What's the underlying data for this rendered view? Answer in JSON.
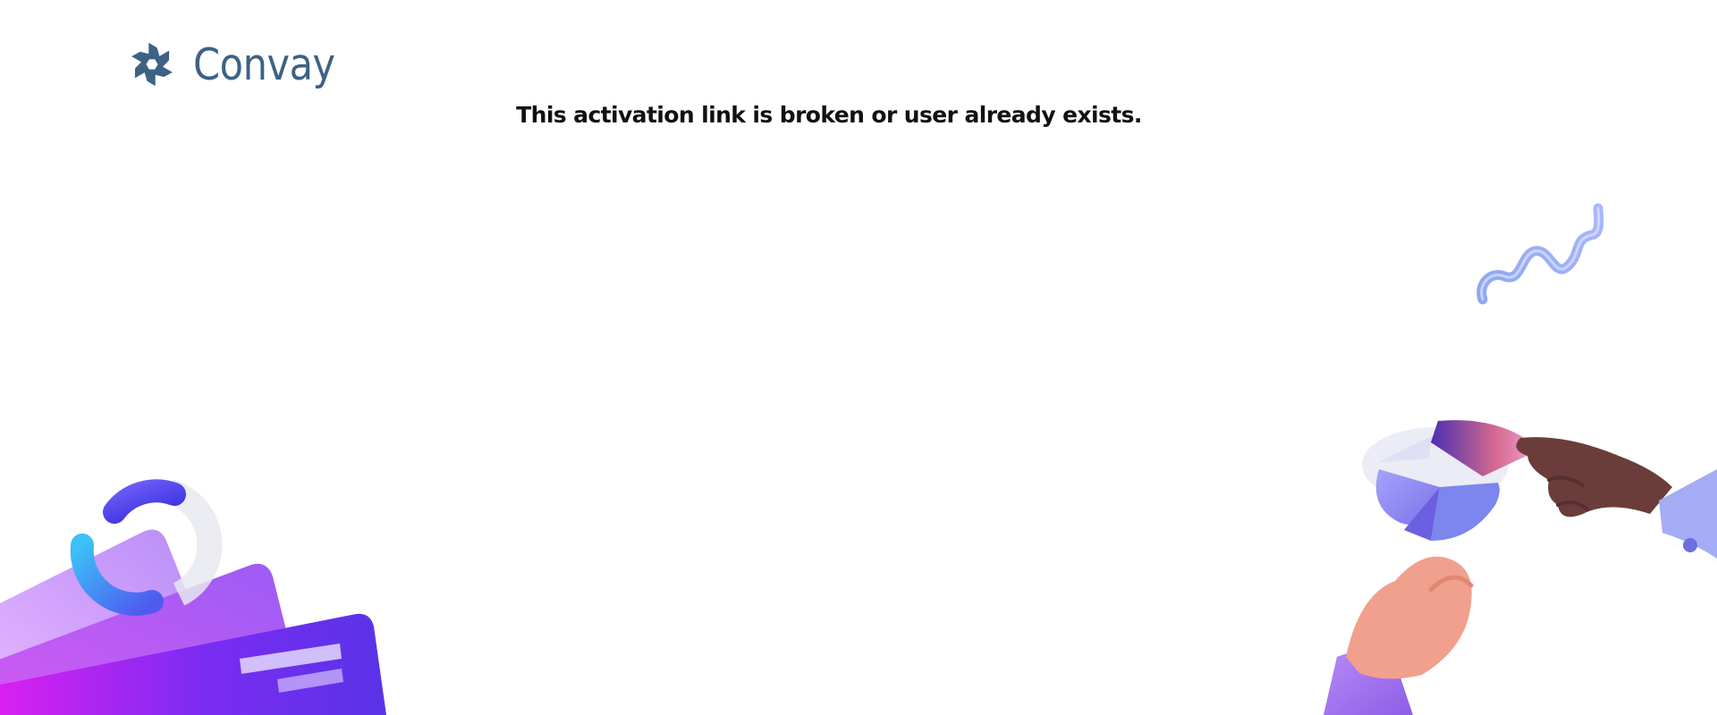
{
  "brand": {
    "name": "Convay",
    "logo_icon": "snowflake-logo-icon",
    "color": "#3d6283"
  },
  "message": {
    "text": "This activation link is broken or user already exists."
  },
  "decorations": {
    "squiggle": "squiggle-illustration",
    "cards": "credit-cards-donut-illustration",
    "hands": "hands-pie-chart-illustration"
  },
  "colors": {
    "background": "#ffffff",
    "text": "#111111",
    "accent_purple": "#7b3cf0",
    "accent_magenta": "#e02cf0",
    "accent_periwinkle": "#8f8ef0"
  }
}
